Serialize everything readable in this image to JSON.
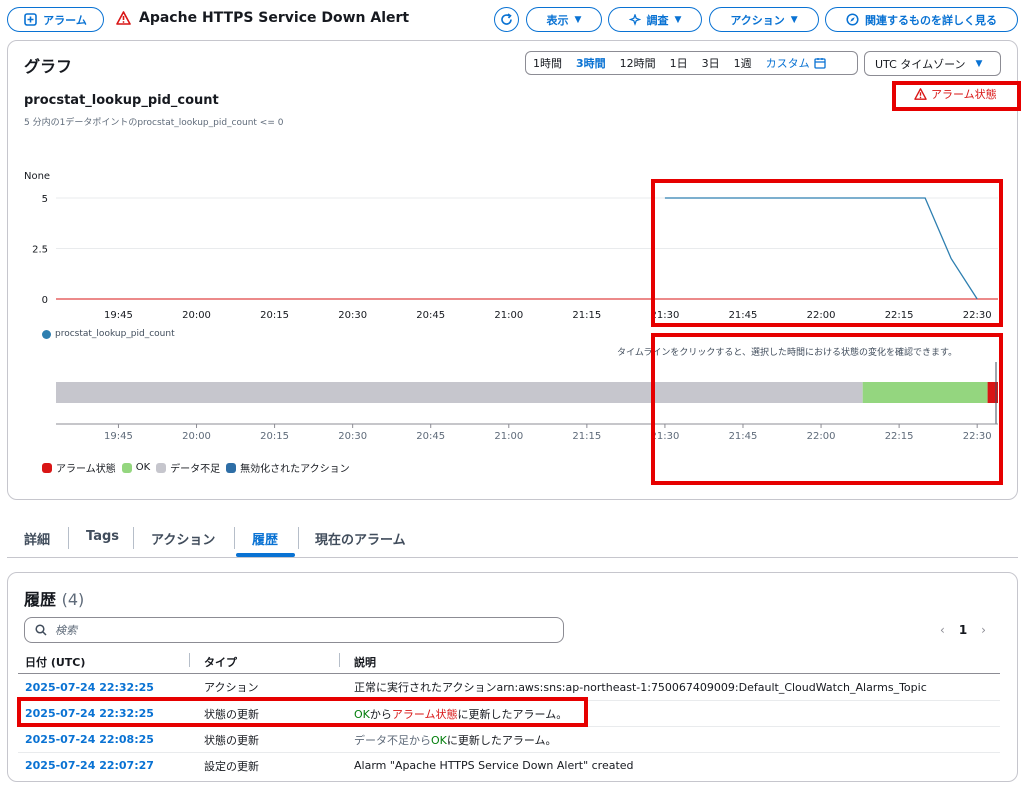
{
  "header": {
    "alarm_btn": "アラーム",
    "title": "Apache HTTPS Service Down Alert",
    "view_btn": "表示",
    "investigate_btn": "調査",
    "action_btn": "アクション",
    "related_btn": "関連するものを詳しく見る"
  },
  "graph": {
    "title": "グラフ",
    "ranges": [
      "1時間",
      "3時間",
      "12時間",
      "1日",
      "3日",
      "1週",
      "カスタム"
    ],
    "active_range": "3時間",
    "timezone": "UTC タイムゾーン",
    "alarm_state_label": "アラーム状態",
    "metric_name": "procstat_lookup_pid_count",
    "condition": "5 分内の1データポイントのprocstat_lookup_pid_count <= 0",
    "y_unit": "None",
    "timeline_hint": "タイムラインをクリックすると、選択した時間における状態の変化を確認できます。"
  },
  "chart_data": {
    "type": "line",
    "ylabel": "None",
    "ylim": [
      0,
      5
    ],
    "y_ticks": [
      "5",
      "2.5",
      "0"
    ],
    "x_ticks": [
      "19:45",
      "20:00",
      "20:15",
      "20:30",
      "20:45",
      "21:00",
      "21:15",
      "21:30",
      "21:45",
      "22:00",
      "22:15",
      "22:30"
    ],
    "series": [
      {
        "name": "procstat_lookup_pid_count",
        "color": "#2e7fb0",
        "points": [
          [
            "21:30",
            5
          ],
          [
            "22:20",
            5
          ],
          [
            "22:25",
            2
          ],
          [
            "22:30",
            0
          ]
        ]
      }
    ],
    "threshold": 0,
    "threshold_color": "#d91515",
    "timeline": [
      {
        "state": "データ不足",
        "from": "19:33",
        "to": "22:08",
        "color": "#c6c6cd"
      },
      {
        "state": "OK",
        "from": "22:08",
        "to": "22:32",
        "color": "#94d67f"
      },
      {
        "state": "アラーム状態",
        "from": "22:32",
        "to": "22:34",
        "color": "#d91515"
      }
    ],
    "legend": [
      {
        "label": "アラーム状態",
        "color": "#d91515"
      },
      {
        "label": "OK",
        "color": "#94d67f"
      },
      {
        "label": "データ不足",
        "color": "#c6c6cd"
      },
      {
        "label": "無効化されたアクション",
        "color": "#2e6ea6"
      }
    ]
  },
  "tabs": [
    "詳細",
    "Tags",
    "アクション",
    "履歴",
    "現在のアラーム"
  ],
  "active_tab": "履歴",
  "history": {
    "title": "履歴",
    "count": "(4)",
    "search_placeholder": "検索",
    "page": "1",
    "columns": [
      "日付 (UTC)",
      "タイプ",
      "説明"
    ],
    "rows": [
      {
        "date": "2025-07-24 22:32:25",
        "type": "アクション",
        "desc": "正常に実行されたアクションarn:aws:sns:ap-northeast-1:750067409009:Default_CloudWatch_Alarms_Topic"
      },
      {
        "date": "2025-07-24 22:32:25",
        "type": "状態の更新",
        "desc_parts": [
          "OK",
          "から",
          "アラーム状態",
          "に更新したアラーム。"
        ]
      },
      {
        "date": "2025-07-24 22:08:25",
        "type": "状態の更新",
        "desc_parts": [
          "データ不足から",
          "OK",
          "に更新したアラーム。"
        ]
      },
      {
        "date": "2025-07-24 22:07:27",
        "type": "設定の更新",
        "desc": "Alarm \"Apache HTTPS Service Down Alert\" created"
      }
    ]
  }
}
